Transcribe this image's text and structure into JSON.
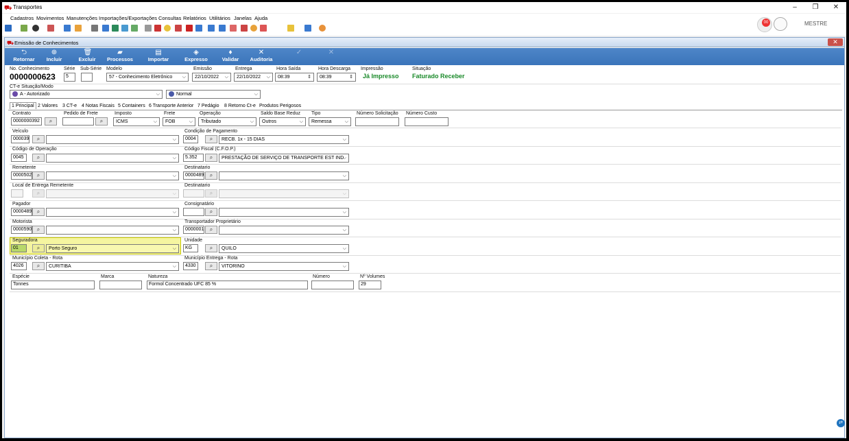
{
  "window": {
    "title": "Transportes"
  },
  "menu": [
    "Cadastros",
    "Movimentos",
    "Manutenções",
    "Importações/Exportações",
    "Consultas",
    "Relatórios",
    "Utilitários",
    "Janelas",
    "Ajuda"
  ],
  "user": {
    "name": "MESTRE",
    "notification_count": "00"
  },
  "form": {
    "title": "Emissão de Conhecimentos",
    "ribbon": [
      {
        "label": "Retornar",
        "icon": "back-arrow-icon"
      },
      {
        "label": "Incluir",
        "icon": "add-icon"
      },
      {
        "label": "Excluir",
        "icon": "trash-icon"
      },
      {
        "label": "Processos",
        "icon": "truck-icon"
      },
      {
        "label": "Importar",
        "icon": "import-icon"
      },
      {
        "label": "Expresso",
        "icon": "express-icon"
      },
      {
        "label": "Validar",
        "icon": "validate-icon"
      },
      {
        "label": "Auditoria",
        "icon": "tools-icon"
      }
    ],
    "header": {
      "no_conhecimento_label": "No. Conhecimento",
      "no_conhecimento": "0000000623",
      "serie_label": "Série",
      "serie": "5",
      "subserie_label": "Sub-Série",
      "subserie": "",
      "modelo_label": "Modelo",
      "modelo": "57 - Conhecimento Eletrônico",
      "emissao_label": "Emissão",
      "emissao": "22/10/2022",
      "entrega_label": "Entrega",
      "entrega": "22/10/2022",
      "hora_saida_label": "Hora Saída",
      "hora_saida": "08:39",
      "hora_descarga_label": "Hora Descarga",
      "hora_descarga": "08:39",
      "impressao_label": "Impressão",
      "impressao": "Já Impresso",
      "situacao_label": "Situação",
      "situacao": "Faturado Receber"
    },
    "cte": {
      "label": "CT-e Situação/Modo",
      "situacao": "A - Autorizado",
      "modo": "Normal"
    },
    "tabs": [
      "1 Principal",
      "2 Valores",
      "3 CT-e",
      "4 Notas Fiscais",
      "5 Containers",
      "6 Transporte Anterior",
      "7 Pedágio",
      "8 Retorno Ct-e",
      "Produtos Perigosos"
    ],
    "principal": {
      "contrato_label": "Contrato",
      "contrato": "0000000392",
      "pedido_label": "Pedido de Frete",
      "pedido": "",
      "imposto_label": "Imposto",
      "imposto": "ICMS",
      "frete_label": "Frete",
      "frete": "FOB",
      "operacao_label": "Operação",
      "operacao": "Tributado",
      "saldo_label": "Saldo Base Reduz",
      "saldo": "Outros",
      "tipo_label": "Tipo",
      "tipo": "Remessa",
      "num_solic_label": "Número Solicitação",
      "num_solic": "",
      "num_custo_label": "Número Custo",
      "num_custo": "",
      "veiculo_label": "Veículo",
      "veiculo_code": "000039",
      "veiculo_name": "",
      "cond_pag_label": "Condição de Pagamento",
      "cond_pag_code": "0004",
      "cond_pag": "RECB. 1x - 15 DIAS",
      "cod_op_label": "Código de Operação",
      "cod_op_code": "0045",
      "cod_op": "",
      "cfop_label": "Código Fiscal (C.F.O.P.)",
      "cfop_code": "5.352",
      "cfop": "PRESTAÇÃO DE SERVIÇO DE TRANSPORTE EST IND",
      "remetente_label": "Remetente",
      "remetente_code": "0000502",
      "remetente": "",
      "destinatario_label": "Destinatario",
      "destinatario_code": "0000489",
      "destinatario": "",
      "local_entrega_label": "Local de Entrega Remetente",
      "local_entrega_code": "",
      "local_entrega": "",
      "destinatario2_label": "Destinatario",
      "destinatario2_code": "",
      "destinatario2": "",
      "pagador_label": "Pagador",
      "pagador_code": "0000489",
      "pagador": "",
      "consignatario_label": "Consignatário",
      "consignatario_code": "",
      "consignatario": "",
      "motorista_label": "Motorista",
      "motorista_code": "0000590",
      "motorista": "",
      "transportador_label": "Transportador Proprietário",
      "transportador_code": "0000001",
      "transportador": "",
      "seguradora_label": "Seguradora",
      "seguradora_code": "01",
      "seguradora": "Porto Seguro",
      "unidade_label": "Unidade",
      "unidade_code": "KG",
      "unidade": "QUILO",
      "mun_coleta_label": "Município Coleta - Rota",
      "mun_coleta_code": "4026",
      "mun_coleta": "CURITIBA",
      "mun_entrega_label": "Município Entrega - Rota",
      "mun_entrega_code": "4330",
      "mun_entrega": "VITORINO",
      "especie_label": "Espécie",
      "especie": "Tonnes",
      "marca_label": "Marca",
      "marca": "",
      "natureza_label": "Natureza",
      "natureza": "Formol Concentrado UFC 85 %",
      "numero_label": "Número",
      "numero": "",
      "volumes_label": "Nº Volumes",
      "volumes": "29"
    }
  }
}
